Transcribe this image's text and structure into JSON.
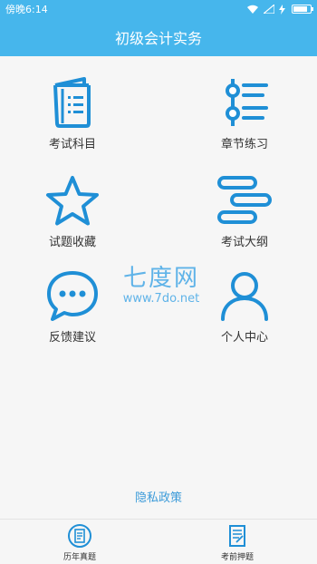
{
  "status": {
    "time": "傍晚6:14",
    "battery_level": 0.85
  },
  "header": {
    "title": "初级会计实务"
  },
  "menu": [
    {
      "label": "考试科目",
      "icon": "notebook-icon"
    },
    {
      "label": "章节练习",
      "icon": "chapter-list-icon"
    },
    {
      "label": "试题收藏",
      "icon": "star-icon"
    },
    {
      "label": "考试大纲",
      "icon": "outline-icon"
    },
    {
      "label": "反馈建议",
      "icon": "chat-bubble-icon"
    },
    {
      "label": "个人中心",
      "icon": "person-icon"
    }
  ],
  "watermark": {
    "logo": "七度网",
    "url": "www.7do.net"
  },
  "privacy_label": "隐私政策",
  "bottom_nav": [
    {
      "label": "历年真题",
      "icon": "past-papers-icon"
    },
    {
      "label": "考前押题",
      "icon": "exam-prediction-icon"
    }
  ],
  "colors": {
    "accent": "#46b6ec",
    "icon": "#1f8fd6",
    "link": "#3c9bd9"
  }
}
